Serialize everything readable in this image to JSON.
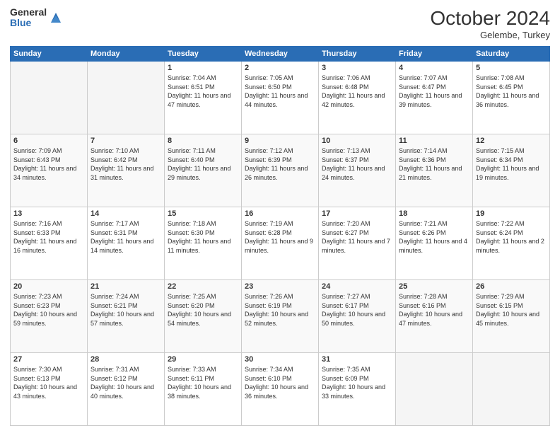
{
  "header": {
    "logo_general": "General",
    "logo_blue": "Blue",
    "month_title": "October 2024",
    "location": "Gelembe, Turkey"
  },
  "weekdays": [
    "Sunday",
    "Monday",
    "Tuesday",
    "Wednesday",
    "Thursday",
    "Friday",
    "Saturday"
  ],
  "weeks": [
    [
      {
        "day": "",
        "empty": true
      },
      {
        "day": "",
        "empty": true
      },
      {
        "day": "1",
        "sunrise": "Sunrise: 7:04 AM",
        "sunset": "Sunset: 6:51 PM",
        "daylight": "Daylight: 11 hours and 47 minutes."
      },
      {
        "day": "2",
        "sunrise": "Sunrise: 7:05 AM",
        "sunset": "Sunset: 6:50 PM",
        "daylight": "Daylight: 11 hours and 44 minutes."
      },
      {
        "day": "3",
        "sunrise": "Sunrise: 7:06 AM",
        "sunset": "Sunset: 6:48 PM",
        "daylight": "Daylight: 11 hours and 42 minutes."
      },
      {
        "day": "4",
        "sunrise": "Sunrise: 7:07 AM",
        "sunset": "Sunset: 6:47 PM",
        "daylight": "Daylight: 11 hours and 39 minutes."
      },
      {
        "day": "5",
        "sunrise": "Sunrise: 7:08 AM",
        "sunset": "Sunset: 6:45 PM",
        "daylight": "Daylight: 11 hours and 36 minutes."
      }
    ],
    [
      {
        "day": "6",
        "sunrise": "Sunrise: 7:09 AM",
        "sunset": "Sunset: 6:43 PM",
        "daylight": "Daylight: 11 hours and 34 minutes."
      },
      {
        "day": "7",
        "sunrise": "Sunrise: 7:10 AM",
        "sunset": "Sunset: 6:42 PM",
        "daylight": "Daylight: 11 hours and 31 minutes."
      },
      {
        "day": "8",
        "sunrise": "Sunrise: 7:11 AM",
        "sunset": "Sunset: 6:40 PM",
        "daylight": "Daylight: 11 hours and 29 minutes."
      },
      {
        "day": "9",
        "sunrise": "Sunrise: 7:12 AM",
        "sunset": "Sunset: 6:39 PM",
        "daylight": "Daylight: 11 hours and 26 minutes."
      },
      {
        "day": "10",
        "sunrise": "Sunrise: 7:13 AM",
        "sunset": "Sunset: 6:37 PM",
        "daylight": "Daylight: 11 hours and 24 minutes."
      },
      {
        "day": "11",
        "sunrise": "Sunrise: 7:14 AM",
        "sunset": "Sunset: 6:36 PM",
        "daylight": "Daylight: 11 hours and 21 minutes."
      },
      {
        "day": "12",
        "sunrise": "Sunrise: 7:15 AM",
        "sunset": "Sunset: 6:34 PM",
        "daylight": "Daylight: 11 hours and 19 minutes."
      }
    ],
    [
      {
        "day": "13",
        "sunrise": "Sunrise: 7:16 AM",
        "sunset": "Sunset: 6:33 PM",
        "daylight": "Daylight: 11 hours and 16 minutes."
      },
      {
        "day": "14",
        "sunrise": "Sunrise: 7:17 AM",
        "sunset": "Sunset: 6:31 PM",
        "daylight": "Daylight: 11 hours and 14 minutes."
      },
      {
        "day": "15",
        "sunrise": "Sunrise: 7:18 AM",
        "sunset": "Sunset: 6:30 PM",
        "daylight": "Daylight: 11 hours and 11 minutes."
      },
      {
        "day": "16",
        "sunrise": "Sunrise: 7:19 AM",
        "sunset": "Sunset: 6:28 PM",
        "daylight": "Daylight: 11 hours and 9 minutes."
      },
      {
        "day": "17",
        "sunrise": "Sunrise: 7:20 AM",
        "sunset": "Sunset: 6:27 PM",
        "daylight": "Daylight: 11 hours and 7 minutes."
      },
      {
        "day": "18",
        "sunrise": "Sunrise: 7:21 AM",
        "sunset": "Sunset: 6:26 PM",
        "daylight": "Daylight: 11 hours and 4 minutes."
      },
      {
        "day": "19",
        "sunrise": "Sunrise: 7:22 AM",
        "sunset": "Sunset: 6:24 PM",
        "daylight": "Daylight: 11 hours and 2 minutes."
      }
    ],
    [
      {
        "day": "20",
        "sunrise": "Sunrise: 7:23 AM",
        "sunset": "Sunset: 6:23 PM",
        "daylight": "Daylight: 10 hours and 59 minutes."
      },
      {
        "day": "21",
        "sunrise": "Sunrise: 7:24 AM",
        "sunset": "Sunset: 6:21 PM",
        "daylight": "Daylight: 10 hours and 57 minutes."
      },
      {
        "day": "22",
        "sunrise": "Sunrise: 7:25 AM",
        "sunset": "Sunset: 6:20 PM",
        "daylight": "Daylight: 10 hours and 54 minutes."
      },
      {
        "day": "23",
        "sunrise": "Sunrise: 7:26 AM",
        "sunset": "Sunset: 6:19 PM",
        "daylight": "Daylight: 10 hours and 52 minutes."
      },
      {
        "day": "24",
        "sunrise": "Sunrise: 7:27 AM",
        "sunset": "Sunset: 6:17 PM",
        "daylight": "Daylight: 10 hours and 50 minutes."
      },
      {
        "day": "25",
        "sunrise": "Sunrise: 7:28 AM",
        "sunset": "Sunset: 6:16 PM",
        "daylight": "Daylight: 10 hours and 47 minutes."
      },
      {
        "day": "26",
        "sunrise": "Sunrise: 7:29 AM",
        "sunset": "Sunset: 6:15 PM",
        "daylight": "Daylight: 10 hours and 45 minutes."
      }
    ],
    [
      {
        "day": "27",
        "sunrise": "Sunrise: 7:30 AM",
        "sunset": "Sunset: 6:13 PM",
        "daylight": "Daylight: 10 hours and 43 minutes."
      },
      {
        "day": "28",
        "sunrise": "Sunrise: 7:31 AM",
        "sunset": "Sunset: 6:12 PM",
        "daylight": "Daylight: 10 hours and 40 minutes."
      },
      {
        "day": "29",
        "sunrise": "Sunrise: 7:33 AM",
        "sunset": "Sunset: 6:11 PM",
        "daylight": "Daylight: 10 hours and 38 minutes."
      },
      {
        "day": "30",
        "sunrise": "Sunrise: 7:34 AM",
        "sunset": "Sunset: 6:10 PM",
        "daylight": "Daylight: 10 hours and 36 minutes."
      },
      {
        "day": "31",
        "sunrise": "Sunrise: 7:35 AM",
        "sunset": "Sunset: 6:09 PM",
        "daylight": "Daylight: 10 hours and 33 minutes."
      },
      {
        "day": "",
        "empty": true
      },
      {
        "day": "",
        "empty": true
      }
    ]
  ]
}
